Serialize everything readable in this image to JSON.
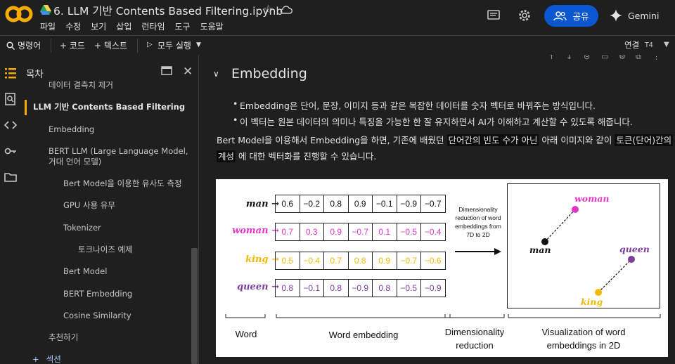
{
  "app": {
    "title": "6. LLM 기반 Contents Based Filtering.ipynb",
    "menu": [
      "파일",
      "수정",
      "보기",
      "삽입",
      "런타임",
      "도구",
      "도움말"
    ],
    "share_label": "공유",
    "gemini_label": "Gemini"
  },
  "toolbar": {
    "commands_label": "명령어",
    "code_label": "+ 코드",
    "text_label": "+ 텍스트",
    "run_all_label": "모두 실행",
    "connect_label": "연결",
    "runtime_label": "T4"
  },
  "sidebar": {
    "title": "목차",
    "items": [
      {
        "label": "데이터 결측치 제거",
        "level": 1
      },
      {
        "label": "LLM 기반 Contents Based Filtering",
        "level": 0,
        "active": true
      },
      {
        "label": "Embedding",
        "level": 1
      },
      {
        "label": "BERT LLM (Large Language Model,",
        "level": 1
      },
      {
        "label": "거대 언어 모델)",
        "level": 1
      },
      {
        "label": "Bert Model을 이용한 유사도 측정",
        "level": 2
      },
      {
        "label": "GPU 사용 유무",
        "level": 2
      },
      {
        "label": "Tokenizer",
        "level": 2
      },
      {
        "label": "토크나이즈 예제",
        "level": 3
      },
      {
        "label": "Bert Model",
        "level": 2
      },
      {
        "label": "BERT Embedding",
        "level": 2
      },
      {
        "label": "Cosine Similarity",
        "level": 2
      },
      {
        "label": "추천하기",
        "level": 1
      }
    ],
    "add_section_label": "섹션"
  },
  "cell": {
    "heading": "Embedding",
    "bullets": [
      "Embedding은 단어, 문장, 이미지 등과 같은 복잡한 데이터를 숫자 벡터로 바꿔주는 방식입니다.",
      "이 벡터는 원본 데이터의 의미나 특징을 가능한 한 잘 유지하면서 AI가 이해하고 계산할 수 있도록 해줍니다."
    ],
    "para_1": "Bert Model을 이용해서 Embedding을 하면, 기존에 배웠던 ",
    "para_hl1": "단어간의 빈도 수가 아닌",
    "para_2": " 아래 이미지와 같이 ",
    "para_hl2a": "토큰(단어)간의",
    "para_hl2b": "계성",
    "para_3": " 에 대한 벡터화를 진행할 수 있습니다."
  },
  "figure": {
    "rows": [
      {
        "word": "man",
        "color": "#111111",
        "values": [
          "0.6",
          "−0.2",
          "0.8",
          "0.9",
          "−0.1",
          "−0.9",
          "−0.7"
        ]
      },
      {
        "word": "woman",
        "color": "#e535c9",
        "values": [
          "0.7",
          "0.3",
          "0.9",
          "−0.7",
          "0.1",
          "−0.5",
          "−0.4"
        ]
      },
      {
        "word": "king",
        "color": "#f5b800",
        "values": [
          "0.5",
          "−0.4",
          "0.7",
          "0.8",
          "0.9",
          "−0.7",
          "−0.6"
        ]
      },
      {
        "word": "queen",
        "color": "#7a3fa0",
        "values": [
          "0.8",
          "−0.1",
          "0.8",
          "−0.9",
          "0.8",
          "−0.5",
          "−0.9"
        ]
      }
    ],
    "arrow": "→",
    "dimred_text": "Dimensionality reduction of word embeddings from 7D to 2D",
    "points": {
      "man": "man",
      "woman": "woman",
      "king": "king",
      "queen": "queen"
    },
    "captions": {
      "word": "Word",
      "embedding": "Word embedding",
      "dimred": "Dimensionality reduction",
      "viz": "Visualization of word embeddings  in 2D"
    }
  }
}
